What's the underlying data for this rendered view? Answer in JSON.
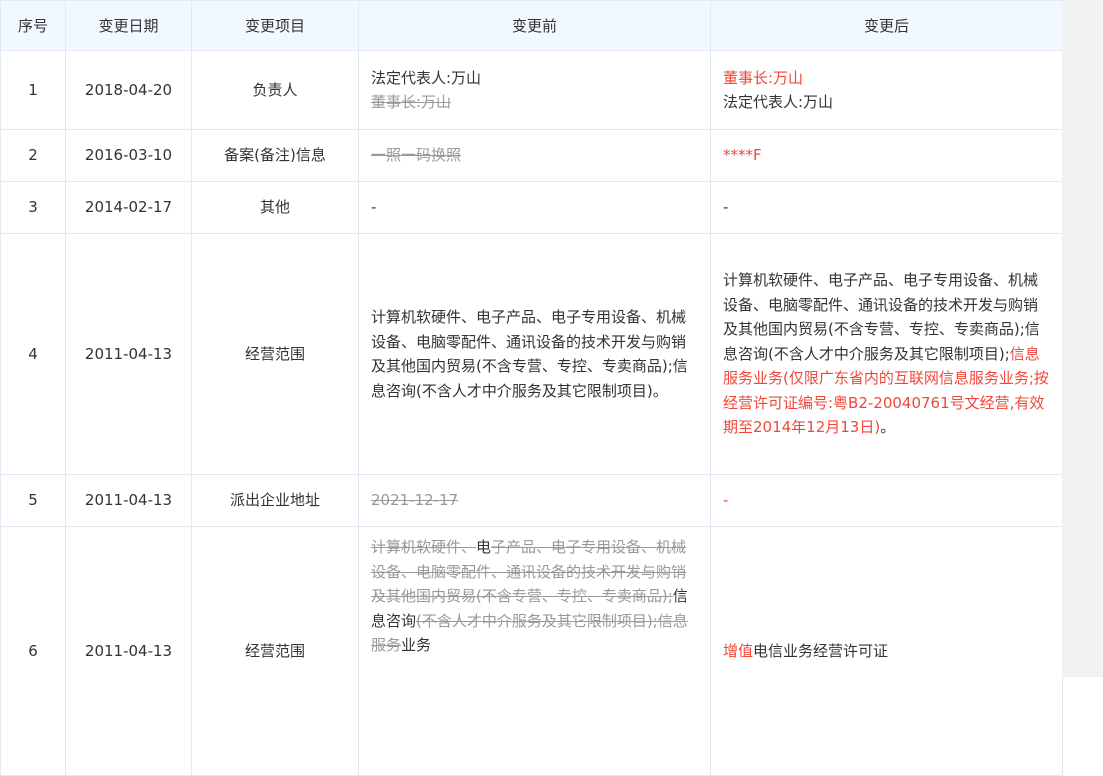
{
  "headers": [
    "序号",
    "变更日期",
    "变更项目",
    "变更前",
    "变更后"
  ],
  "rows": [
    {
      "index": "1",
      "date": "2018-04-20",
      "item": "负责人",
      "before": {
        "normal": "法定代表人:万山",
        "removed": "董事长:万山"
      },
      "after": {
        "added": "董事长:万山",
        "normal": "法定代表人:万山"
      }
    },
    {
      "index": "2",
      "date": "2016-03-10",
      "item": "备案(备注)信息",
      "before": {
        "removed": "一照一码换照"
      },
      "after": {
        "added": "****F"
      }
    },
    {
      "index": "3",
      "date": "2014-02-17",
      "item": "其他",
      "before": {
        "normal": "-"
      },
      "after": {
        "normal": "-"
      }
    },
    {
      "index": "4",
      "date": "2011-04-13",
      "item": "经营范围",
      "before": {
        "normal": "计算机软硬件、电子产品、电子专用设备、机械设备、电脑零配件、通讯设备的技术开发与购销及其他国内贸易(不含专营、专控、专卖商品);信息咨询(不含人才中介服务及其它限制项目)。"
      },
      "after": {
        "normal": "计算机软硬件、电子产品、电子专用设备、机械设备、电脑零配件、通讯设备的技术开发与购销及其他国内贸易(不含专营、专控、专卖商品);信息咨询(不含人才中介服务及其它限制项目);",
        "added": "信息服务业务(仅限广东省内的互联网信息服务业务;按经营许可证编号:粤B2-20040761号文经营,有效期至2014年12月13日)",
        "tail": "。"
      }
    },
    {
      "index": "5",
      "date": "2011-04-13",
      "item": "派出企业地址",
      "before": {
        "removed": "2021-12-17"
      },
      "after": {
        "added": "-"
      }
    },
    {
      "index": "6",
      "date": "2011-04-13",
      "item": "经营范围",
      "before": {
        "removed_1": "计算机软硬件、",
        "normal_1": "电",
        "removed_2": "子产品、电子专用设备、机械设备、电脑零配件、通讯设备的技术开发与购销及其他国内贸易(不含专营、专控、专卖商品);",
        "normal_2": "信息咨询",
        "removed_3": "(不含人才中介服务及其它限制项目);信息服务",
        "normal_3": "业务"
      },
      "after": {
        "added": "增值",
        "normal": "电信业务经营许可证"
      }
    }
  ]
}
